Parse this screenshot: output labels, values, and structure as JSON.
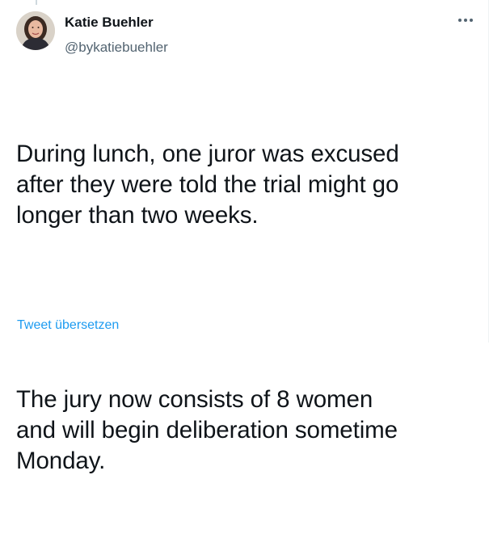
{
  "tweet": {
    "author": {
      "name": "Katie Buehler",
      "handle": "@bykatiebuehler",
      "avatar_icon": "profile-photo"
    },
    "more_icon": "more-horizontal-icon",
    "text_paragraphs": [
      "During lunch, one juror was excused\nafter they were told the trial might go\nlonger than two weeks.",
      "The jury now consists of 8 women\nand will begin deliberation sometime\nMonday."
    ],
    "translate_label": "Tweet übersetzen"
  },
  "colors": {
    "text": "#0f1419",
    "secondary": "#536471",
    "link": "#1d9bf0"
  }
}
